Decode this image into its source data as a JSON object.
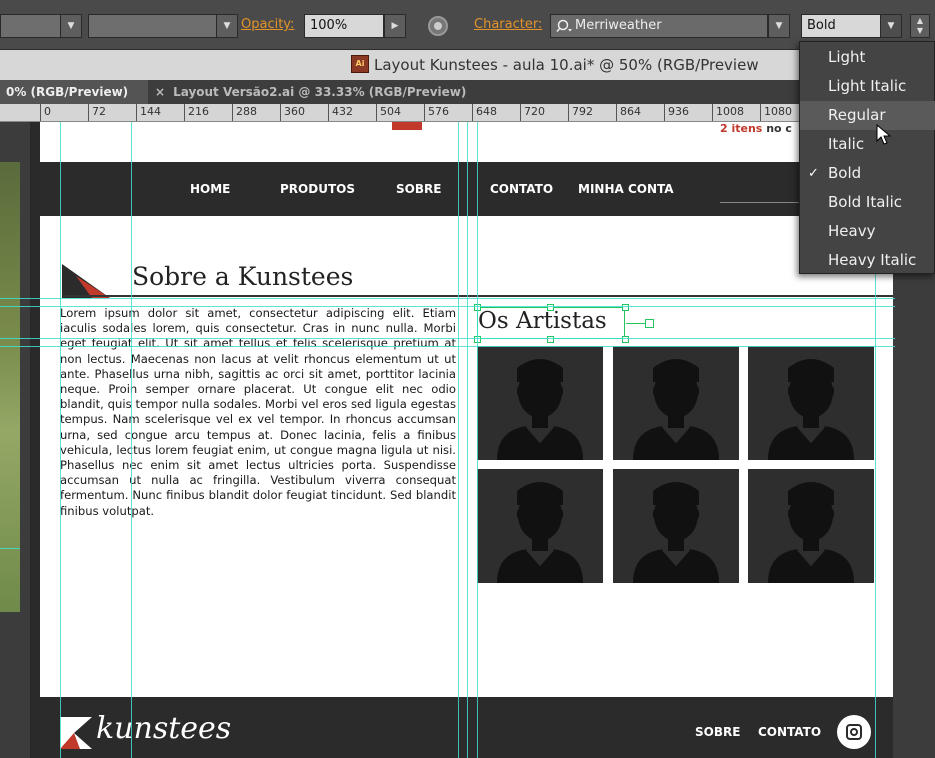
{
  "control_bar": {
    "opacity_label": "Opacity:",
    "opacity_value": "100%",
    "character_label": "Character:",
    "font_family": "Merriweather",
    "font_style": "Bold"
  },
  "document": {
    "title": "Layout Kunstees - aula 10.ai* @ 50% (RGB/Preview",
    "tabs": [
      {
        "label": "0% (RGB/Preview)",
        "active": true
      },
      {
        "label": "Layout Versão2.ai @ 33.33% (RGB/Preview)",
        "active": false
      }
    ],
    "tab_close": "×"
  },
  "ruler": {
    "ticks": [
      "0",
      "72",
      "144",
      "216",
      "288",
      "360",
      "432",
      "504",
      "576",
      "648",
      "720",
      "792",
      "864",
      "936",
      "1008",
      "1080"
    ]
  },
  "artboard": {
    "cart_count": "2 itens",
    "cart_rest": " no c",
    "nav": [
      "HOME",
      "PRODUTOS",
      "SOBRE",
      "CONTATO",
      "MINHA CONTA"
    ],
    "section_title": "Sobre a Kunstees",
    "body_text": "Lorem ipsum dolor sit amet, consectetur adipiscing elit. Etiam iaculis sodales lorem, quis consectetur. Cras in nunc nulla. Morbi eget feugiat elit. Ut sit amet tellus et felis scelerisque pretium at non lectus. Maecenas non lacus at velit rhoncus elementum ut ut ante. Phasellus urna nibh, sagittis ac orci sit amet, porttitor lacinia neque. Proin semper ornare placerat. Ut congue elit nec odio blandit, quis tempor nulla sodales. Morbi vel eros sed ligula egestas tempus. Nam scelerisque vel ex vel tempor. In rhoncus accumsan urna, sed congue arcu tempus at. Donec lacinia, felis a finibus vehicula, lectus lorem feugiat enim, ut congue magna ligula ut nisi. Phasellus nec enim sit amet lectus ultricies porta. Suspendisse accumsan ut nulla ac fringilla. Vestibulum viverra consequat fermentum. Nunc finibus blandit dolor feugiat tincidunt. Sed blandit finibus volutpat.",
    "artists_title": "Os Artistas",
    "artist_count": 6,
    "footer_brand": "kunstees",
    "footer_links": [
      "SOBRE",
      "CONTATO"
    ]
  },
  "font_style_menu": {
    "items": [
      "Light",
      "Light Italic",
      "Regular",
      "Italic",
      "Bold",
      "Bold Italic",
      "Heavy",
      "Heavy Italic"
    ],
    "checked": "Bold",
    "hovered": "Regular"
  },
  "colors": {
    "accent_orange": "#e2932b",
    "brand_red": "#c0392b",
    "guide_cyan": "#40e0d0",
    "selection_green": "#22c55e",
    "nav_dark": "#2b2b2b"
  }
}
